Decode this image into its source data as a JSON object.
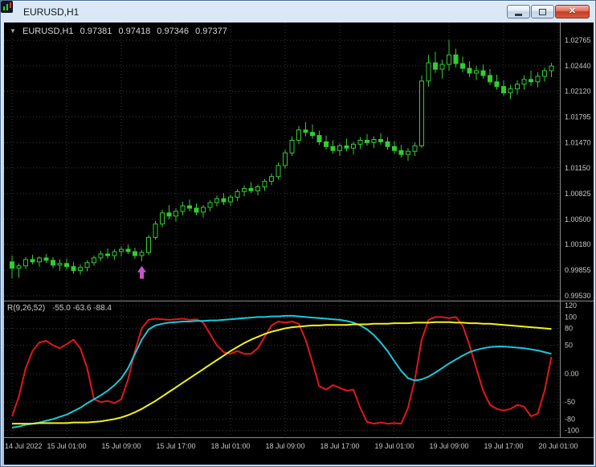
{
  "window": {
    "title": "EURUSD,H1"
  },
  "icons": {
    "app_icon": "candlestick-chart",
    "symbol_marker": "▼",
    "minimize": "minimize-bar",
    "maximize": "maximize-square",
    "close": "✕"
  },
  "chart": {
    "info": {
      "symbol": "EURUSD,H1",
      "open": "0.97381",
      "high": "0.97418",
      "low": "0.97346",
      "close": "0.97377"
    }
  },
  "indicator_label": {
    "name": "R(9,26,52)",
    "values": "-55.0 -63.6 -88.4"
  },
  "axes": {
    "price_labels": [
      "1.02765",
      "1.02440",
      "1.02120",
      "1.01795",
      "1.01470",
      "1.01150",
      "1.00825",
      "1.00500",
      "1.00180",
      "0.99855",
      "0.99530"
    ],
    "indicator_labels": [
      "120",
      "100",
      "80",
      "50",
      "0.00",
      "-50",
      "-80",
      "-100"
    ],
    "time_labels": [
      "14 Jul 2022",
      "15 Jul 01:00",
      "15 Jul 09:00",
      "15 Jul 17:00",
      "18 Jul 01:00",
      "18 Jul 09:00",
      "18 Jul 17:00",
      "19 Jul 01:00",
      "19 Jul 09:00",
      "19 Jul 17:00",
      "20 Jul 01:00"
    ]
  },
  "colors": {
    "background": "#000000",
    "grid": "#3a3a3a",
    "separator": "#8a8a8a",
    "axis_text": "#c9c9c9",
    "candle": "#32cc32",
    "arrow": "#c654c6",
    "line_red": "#e0181c",
    "line_cyan": "#19c9dc",
    "line_yellow": "#f2f21c"
  },
  "chart_data": {
    "type": "candlestick+oscillator",
    "symbol": "EURUSD",
    "timeframe": "H1",
    "price_range": {
      "min": 0.9947,
      "max": 1.0297
    },
    "time_grid_indices": [
      0,
      8,
      16,
      24,
      32,
      40,
      48,
      56,
      64,
      72,
      80
    ],
    "candles": [
      [
        0.9996,
        1.0004,
        0.9975,
        0.9988
      ],
      [
        0.9988,
        0.9994,
        0.9976,
        0.9991
      ],
      [
        0.9991,
        1.0002,
        0.9987,
        0.9999
      ],
      [
        0.9999,
        1.0005,
        0.9993,
        0.9996
      ],
      [
        0.9996,
        1.0003,
        0.999,
        1.0001
      ],
      [
        1.0001,
        1.0006,
        0.9995,
        0.9998
      ],
      [
        0.9998,
        1.0002,
        0.9988,
        0.9992
      ],
      [
        0.9992,
        0.9999,
        0.9985,
        0.9994
      ],
      [
        0.9994,
        1.0,
        0.9986,
        0.999
      ],
      [
        0.999,
        0.9996,
        0.9981,
        0.9985
      ],
      [
        0.9985,
        0.9993,
        0.998,
        0.9989
      ],
      [
        0.9989,
        0.9998,
        0.9984,
        0.9995
      ],
      [
        0.9995,
        1.0004,
        0.9991,
        1.0001
      ],
      [
        1.0001,
        1.001,
        0.9997,
        1.0006
      ],
      [
        1.0006,
        1.0013,
        1.0,
        1.0004
      ],
      [
        1.0004,
        1.0012,
        0.9999,
        1.0009
      ],
      [
        1.0009,
        1.0016,
        1.0003,
        1.0012
      ],
      [
        1.0012,
        1.0018,
        1.0006,
        1.0009
      ],
      [
        1.0009,
        1.0014,
        1.0,
        1.0004
      ],
      [
        1.0004,
        1.0011,
        0.9997,
        1.0008
      ],
      [
        1.0008,
        1.003,
        1.0005,
        1.0027
      ],
      [
        1.0027,
        1.0048,
        1.0024,
        1.0044
      ],
      [
        1.0044,
        1.0062,
        1.004,
        1.0058
      ],
      [
        1.0058,
        1.0068,
        1.005,
        1.0054
      ],
      [
        1.0054,
        1.0064,
        1.0047,
        1.006
      ],
      [
        1.006,
        1.0072,
        1.0055,
        1.0067
      ],
      [
        1.0067,
        1.0075,
        1.006,
        1.0064
      ],
      [
        1.0064,
        1.007,
        1.0055,
        1.0059
      ],
      [
        1.0059,
        1.0068,
        1.0052,
        1.0065
      ],
      [
        1.0065,
        1.0074,
        1.006,
        1.0071
      ],
      [
        1.0071,
        1.008,
        1.0066,
        1.0076
      ],
      [
        1.0076,
        1.0083,
        1.0068,
        1.0072
      ],
      [
        1.0072,
        1.0081,
        1.0067,
        1.0078
      ],
      [
        1.0078,
        1.0088,
        1.0073,
        1.0085
      ],
      [
        1.0085,
        1.0093,
        1.0079,
        1.0089
      ],
      [
        1.0089,
        1.0097,
        1.0083,
        1.0086
      ],
      [
        1.0086,
        1.0094,
        1.008,
        1.0091
      ],
      [
        1.0091,
        1.0101,
        1.0086,
        1.0098
      ],
      [
        1.0098,
        1.0108,
        1.0093,
        1.0104
      ],
      [
        1.0104,
        1.0122,
        1.01,
        1.0118
      ],
      [
        1.0118,
        1.0138,
        1.0114,
        1.0134
      ],
      [
        1.0134,
        1.0155,
        1.013,
        1.015
      ],
      [
        1.015,
        1.0168,
        1.0145,
        1.0163
      ],
      [
        1.0163,
        1.0173,
        1.0155,
        1.016
      ],
      [
        1.016,
        1.017,
        1.0152,
        1.0156
      ],
      [
        1.0156,
        1.0162,
        1.0144,
        1.0148
      ],
      [
        1.0148,
        1.0156,
        1.0138,
        1.0142
      ],
      [
        1.0142,
        1.015,
        1.0133,
        1.0137
      ],
      [
        1.0137,
        1.0146,
        1.013,
        1.0143
      ],
      [
        1.0143,
        1.0152,
        1.0136,
        1.014
      ],
      [
        1.014,
        1.0148,
        1.0132,
        1.0145
      ],
      [
        1.0145,
        1.0154,
        1.0139,
        1.015
      ],
      [
        1.015,
        1.0158,
        1.0143,
        1.0147
      ],
      [
        1.0147,
        1.0155,
        1.014,
        1.0151
      ],
      [
        1.0151,
        1.0159,
        1.0144,
        1.0148
      ],
      [
        1.0148,
        1.0154,
        1.0138,
        1.0142
      ],
      [
        1.0142,
        1.0149,
        1.0133,
        1.0137
      ],
      [
        1.0137,
        1.0144,
        1.0128,
        1.0132
      ],
      [
        1.0132,
        1.014,
        1.0124,
        1.0136
      ],
      [
        1.0136,
        1.0147,
        1.013,
        1.0143
      ],
      [
        1.0143,
        1.0232,
        1.014,
        1.0225
      ],
      [
        1.0225,
        1.0258,
        1.0218,
        1.0248
      ],
      [
        1.0248,
        1.0262,
        1.0235,
        1.024
      ],
      [
        1.024,
        1.0252,
        1.0228,
        1.0246
      ],
      [
        1.0246,
        1.0277,
        1.0238,
        1.0258
      ],
      [
        1.0258,
        1.0266,
        1.0242,
        1.0247
      ],
      [
        1.0247,
        1.0256,
        1.0236,
        1.0241
      ],
      [
        1.0241,
        1.025,
        1.023,
        1.0235
      ],
      [
        1.0235,
        1.0244,
        1.0226,
        1.0238
      ],
      [
        1.0238,
        1.0246,
        1.0228,
        1.0232
      ],
      [
        1.0232,
        1.024,
        1.022,
        1.0224
      ],
      [
        1.0224,
        1.0233,
        1.0214,
        1.0218
      ],
      [
        1.0218,
        1.0226,
        1.0206,
        1.021
      ],
      [
        1.021,
        1.022,
        1.0202,
        1.0215
      ],
      [
        1.0215,
        1.0226,
        1.0208,
        1.0221
      ],
      [
        1.0221,
        1.0232,
        1.0214,
        1.0227
      ],
      [
        1.0227,
        1.0238,
        1.0219,
        1.0224
      ],
      [
        1.0224,
        1.0236,
        1.0217,
        1.0231
      ],
      [
        1.0231,
        1.0242,
        1.0224,
        1.0238
      ],
      [
        1.0238,
        1.0248,
        1.023,
        1.0244
      ]
    ],
    "buy_arrow": {
      "bar_index": 19,
      "price": 0.9993
    },
    "oscillator": {
      "range": {
        "min": -112,
        "max": 126
      },
      "levels": [
        120,
        100,
        80,
        50,
        0,
        -50,
        -80,
        -100
      ],
      "series": [
        {
          "name": "fast",
          "color": "#e0181c",
          "values": [
            -75,
            -40,
            10,
            40,
            55,
            58,
            50,
            45,
            52,
            60,
            45,
            10,
            -45,
            -50,
            -48,
            -52,
            -45,
            -10,
            40,
            80,
            95,
            97,
            96,
            95,
            96,
            97,
            95,
            96,
            90,
            70,
            50,
            38,
            35,
            40,
            35,
            35,
            45,
            65,
            85,
            92,
            90,
            92,
            88,
            60,
            20,
            -22,
            -28,
            -20,
            -25,
            -30,
            -28,
            -60,
            -85,
            -88,
            -86,
            -88,
            -87,
            -88,
            -60,
            -10,
            60,
            95,
            100,
            100,
            98,
            100,
            85,
            50,
            10,
            -30,
            -55,
            -62,
            -65,
            -62,
            -55,
            -58,
            -75,
            -70,
            -30,
            30
          ]
        },
        {
          "name": "medium",
          "color": "#19c9dc",
          "values": [
            -95,
            -93,
            -90,
            -88,
            -86,
            -83,
            -80,
            -76,
            -72,
            -66,
            -60,
            -52,
            -45,
            -38,
            -30,
            -20,
            -8,
            10,
            35,
            60,
            78,
            85,
            88,
            90,
            91,
            92,
            92,
            93,
            93,
            94,
            94,
            95,
            96,
            97,
            98,
            99,
            100,
            100,
            101,
            101,
            102,
            102,
            101,
            100,
            99,
            98,
            97,
            96,
            95,
            93,
            90,
            85,
            78,
            68,
            55,
            40,
            22,
            5,
            -8,
            -12,
            -10,
            -5,
            2,
            10,
            18,
            25,
            32,
            38,
            42,
            45,
            47,
            48,
            48,
            47,
            46,
            45,
            43,
            41,
            38,
            35
          ]
        },
        {
          "name": "slow",
          "color": "#f2f21c",
          "values": [
            -88,
            -88,
            -88,
            -88,
            -87,
            -87,
            -87,
            -87,
            -87,
            -86,
            -86,
            -86,
            -85,
            -84,
            -82,
            -80,
            -77,
            -73,
            -68,
            -62,
            -55,
            -48,
            -40,
            -32,
            -24,
            -16,
            -8,
            0,
            8,
            16,
            24,
            32,
            40,
            47,
            54,
            60,
            65,
            70,
            74,
            77,
            80,
            82,
            83,
            84,
            85,
            85,
            86,
            86,
            86,
            86,
            87,
            87,
            87,
            88,
            88,
            88,
            89,
            89,
            89,
            90,
            90,
            90,
            91,
            91,
            91,
            90,
            90,
            89,
            89,
            88,
            88,
            87,
            86,
            85,
            84,
            83,
            82,
            81,
            80,
            79
          ]
        }
      ]
    }
  }
}
